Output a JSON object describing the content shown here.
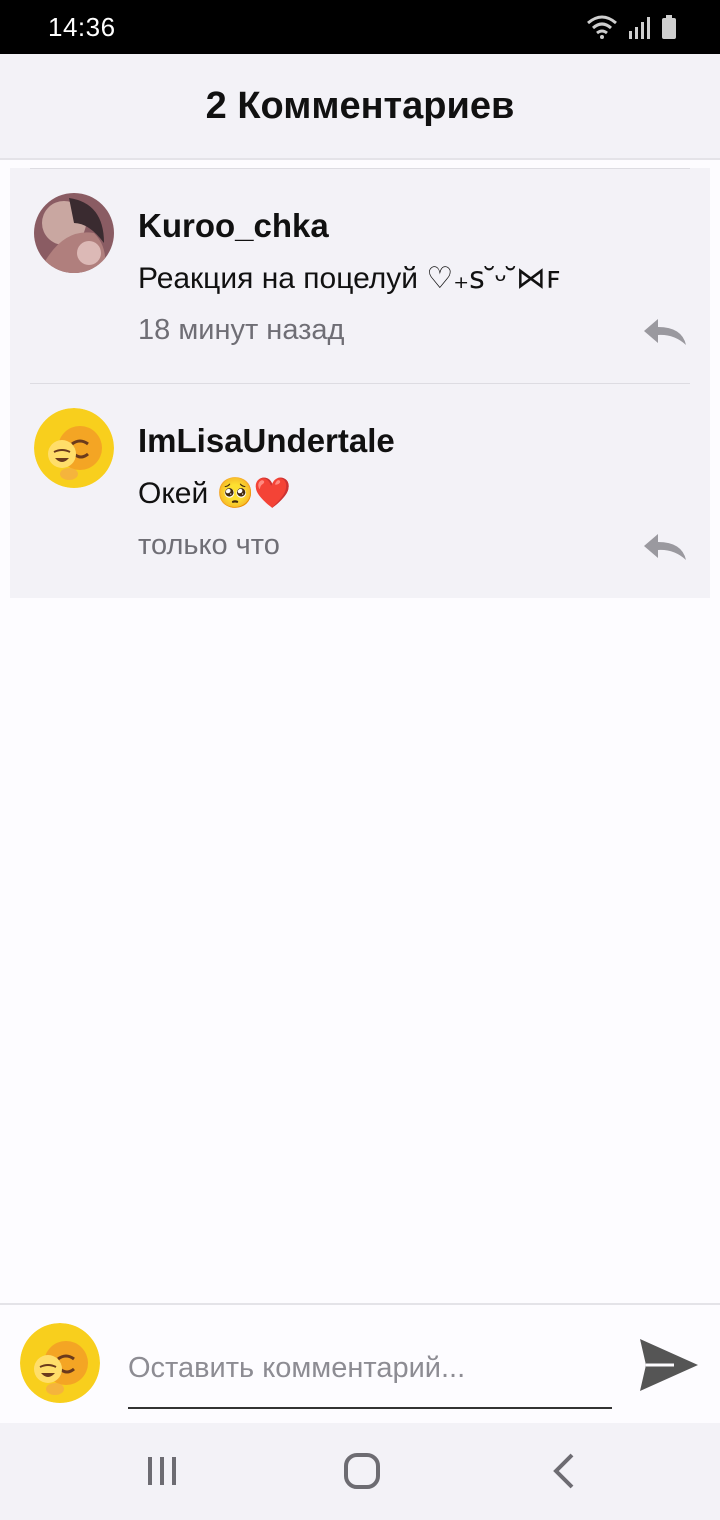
{
  "status_bar": {
    "time": "14:36",
    "icons": [
      "wifi-icon",
      "signal-icon",
      "battery-icon"
    ]
  },
  "header": {
    "title": "2 Комментариев"
  },
  "comments": [
    {
      "username": "Kuroo_chka",
      "text": "Реакция на поцелуй ♡₊ꜱ˘ᵕ˘⋈ꜰ",
      "time": "18 минут назад",
      "avatar": "photo-avatar"
    },
    {
      "username": "ImLisaUndertale",
      "text": "Окей 🥺❤️",
      "time": "только что",
      "avatar": "emoji-avatar"
    }
  ],
  "input": {
    "placeholder": "Оставить комментарий..."
  },
  "nav": {
    "buttons": [
      "recent-apps-icon",
      "home-icon",
      "back-icon"
    ]
  },
  "colors": {
    "header_bg": "#f3f2f7",
    "card_bg": "#f3f2f7",
    "muted_text": "#6f6e75",
    "reply_icon": "#9a999f",
    "send_icon": "#555555",
    "emoji_yellow": "#f8cf1d"
  }
}
